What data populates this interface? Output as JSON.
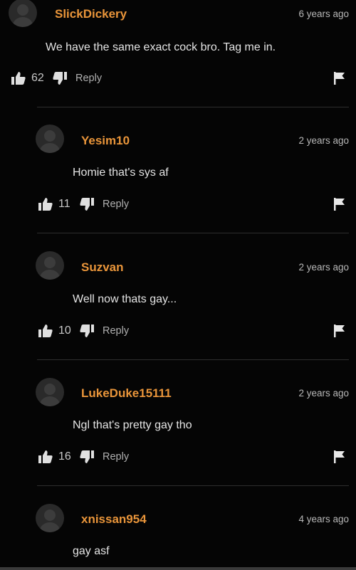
{
  "colors": {
    "background": "#050505",
    "username": "#e9953a",
    "text": "#e4e4e4",
    "muted": "#b8b8b8"
  },
  "icons": {
    "like": "thumbs-up-icon",
    "dislike": "thumbs-down-icon",
    "flag": "flag-icon"
  },
  "comments": [
    {
      "username": "SlickDickery",
      "timestamp": "6 years ago",
      "text": "We have the same exact cock bro. Tag me in.",
      "likes": "62",
      "reply_label": "Reply"
    },
    {
      "username": "Yesim10",
      "timestamp": "2 years ago",
      "text": "Homie that's sys af",
      "likes": "11",
      "reply_label": "Reply"
    },
    {
      "username": "Suzvan",
      "timestamp": "2 years ago",
      "text": "Well now thats gay...",
      "likes": "10",
      "reply_label": "Reply"
    },
    {
      "username": "LukeDuke15111",
      "timestamp": "2 years ago",
      "text": "Ngl that's pretty gay tho",
      "likes": "16",
      "reply_label": "Reply"
    },
    {
      "username": "xnissan954",
      "timestamp": "4 years ago",
      "text": "gay asf"
    }
  ]
}
